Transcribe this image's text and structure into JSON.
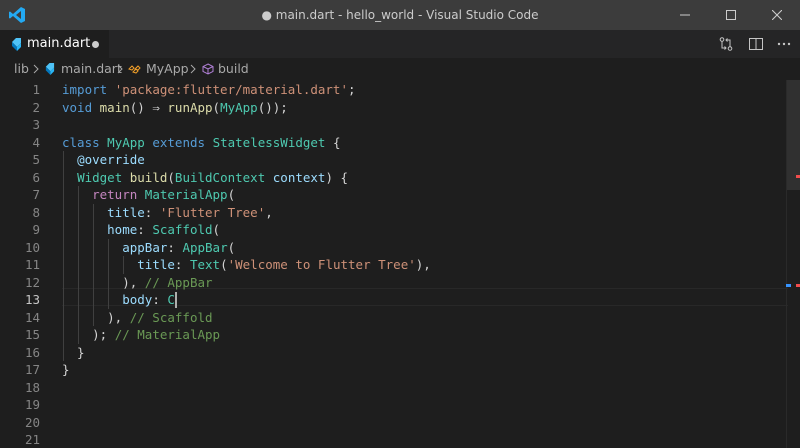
{
  "window": {
    "title": "● main.dart - hello_world - Visual Studio Code"
  },
  "icons": {
    "app": "vscode-logo-icon",
    "minimize": "minimize-icon",
    "maximize": "maximize-icon",
    "close": "close-icon",
    "dart_file": "dart-file-icon",
    "class": "class-icon",
    "method": "method-cube-icon",
    "open_changes": "open-changes-icon",
    "split_editor": "split-editor-icon",
    "more": "more-actions-icon"
  },
  "tab": {
    "label": "main.dart",
    "dirty": true
  },
  "breadcrumbs": {
    "folder": "lib",
    "file": "main.dart",
    "class": "MyApp",
    "method": "build"
  },
  "editor": {
    "active_line": 13,
    "line_numbers": [
      "1",
      "2",
      "3",
      "4",
      "5",
      "6",
      "7",
      "8",
      "9",
      "10",
      "11",
      "12",
      "13",
      "14",
      "15",
      "16",
      "17",
      "18",
      "19",
      "20",
      "21"
    ],
    "lines": [
      [
        [
          "kw",
          "import"
        ],
        [
          "txt",
          " "
        ],
        [
          "str",
          "'package:flutter/material.dart'"
        ],
        [
          "txt",
          ";"
        ]
      ],
      [
        [
          "kw",
          "void"
        ],
        [
          "txt",
          " "
        ],
        [
          "fn",
          "main"
        ],
        [
          "txt",
          "() ⇒ "
        ],
        [
          "fn",
          "runApp"
        ],
        [
          "txt",
          "("
        ],
        [
          "cls",
          "MyApp"
        ],
        [
          "txt",
          "());"
        ]
      ],
      [],
      [
        [
          "kw",
          "class"
        ],
        [
          "txt",
          " "
        ],
        [
          "cls",
          "MyApp"
        ],
        [
          "txt",
          " "
        ],
        [
          "kw",
          "extends"
        ],
        [
          "txt",
          " "
        ],
        [
          "cls",
          "StatelessWidget"
        ],
        [
          "txt",
          " {"
        ]
      ],
      [
        [
          "txt",
          "  "
        ],
        [
          "prm",
          "@override"
        ]
      ],
      [
        [
          "txt",
          "  "
        ],
        [
          "cls",
          "Widget"
        ],
        [
          "txt",
          " "
        ],
        [
          "fn",
          "build"
        ],
        [
          "txt",
          "("
        ],
        [
          "cls",
          "BuildContext"
        ],
        [
          "txt",
          " "
        ],
        [
          "prm",
          "context"
        ],
        [
          "txt",
          ") {"
        ]
      ],
      [
        [
          "txt",
          "    "
        ],
        [
          "ctl",
          "return"
        ],
        [
          "txt",
          " "
        ],
        [
          "cls",
          "MaterialApp"
        ],
        [
          "txt",
          "("
        ]
      ],
      [
        [
          "txt",
          "      "
        ],
        [
          "prm",
          "title"
        ],
        [
          "txt",
          ": "
        ],
        [
          "str",
          "'Flutter Tree'"
        ],
        [
          "txt",
          ","
        ]
      ],
      [
        [
          "txt",
          "      "
        ],
        [
          "prm",
          "home"
        ],
        [
          "txt",
          ": "
        ],
        [
          "cls",
          "Scaffold"
        ],
        [
          "txt",
          "("
        ]
      ],
      [
        [
          "txt",
          "        "
        ],
        [
          "prm",
          "appBar"
        ],
        [
          "txt",
          ": "
        ],
        [
          "cls",
          "AppBar"
        ],
        [
          "txt",
          "("
        ]
      ],
      [
        [
          "txt",
          "          "
        ],
        [
          "prm",
          "title"
        ],
        [
          "txt",
          ": "
        ],
        [
          "cls",
          "Text"
        ],
        [
          "txt",
          "("
        ],
        [
          "str",
          "'Welcome to Flutter Tree'"
        ],
        [
          "txt",
          "),"
        ]
      ],
      [
        [
          "txt",
          "        ), "
        ],
        [
          "cm",
          "// AppBar"
        ]
      ],
      [
        [
          "txt",
          "        "
        ],
        [
          "prm",
          "body"
        ],
        [
          "txt",
          ": "
        ],
        [
          "cls",
          "C"
        ]
      ],
      [
        [
          "txt",
          "      ), "
        ],
        [
          "cm",
          "// Scaffold"
        ]
      ],
      [
        [
          "txt",
          "    ); "
        ],
        [
          "cm",
          "// MaterialApp"
        ]
      ],
      [
        [
          "txt",
          "  }"
        ]
      ],
      [
        [
          "txt",
          "}"
        ]
      ],
      [],
      [],
      [],
      []
    ]
  },
  "colors": {
    "titlebar": "#3c3c3c",
    "editor_bg": "#1e1e1e",
    "tabbar": "#252526",
    "accent_blue": "#007acc",
    "ruler_red": "#f14c4c",
    "ruler_blue": "#3794ff"
  }
}
